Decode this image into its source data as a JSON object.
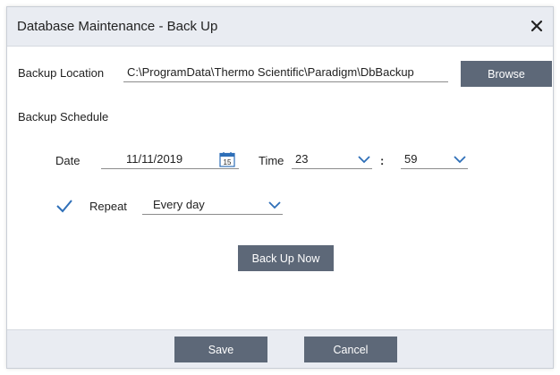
{
  "dialog": {
    "title": "Database Maintenance - Back Up",
    "close_icon": "close-icon"
  },
  "backup_location": {
    "label": "Backup Location",
    "value": "C:\\ProgramData\\Thermo Scientific\\Paradigm\\DbBackup",
    "browse_label": "Browse"
  },
  "schedule": {
    "heading": "Backup Schedule",
    "date_label": "Date",
    "date_value": "11/11/2019",
    "calendar_icon": "calendar-icon",
    "calendar_day": "15",
    "time_label": "Time",
    "hour": "23",
    "separator": ":",
    "minute": "59",
    "repeat_checked": true,
    "repeat_label": "Repeat",
    "repeat_value": "Every day"
  },
  "actions": {
    "backup_now_label": "Back Up Now",
    "save_label": "Save",
    "cancel_label": "Cancel"
  },
  "colors": {
    "button_bg": "#5d6878",
    "titlebar_bg": "#e9ecf2",
    "accent": "#2e6fb8"
  }
}
